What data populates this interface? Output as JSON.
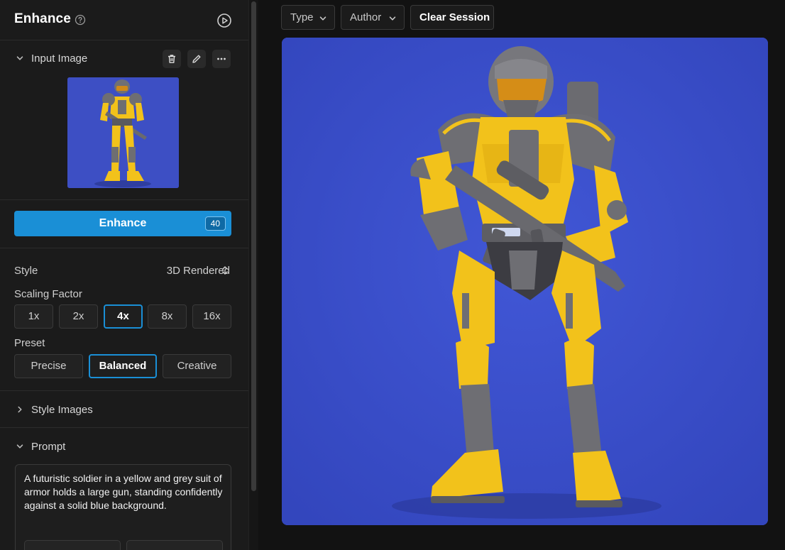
{
  "panel": {
    "title": "Enhance"
  },
  "input_image": {
    "label": "Input Image"
  },
  "enhance_button": {
    "label": "Enhance",
    "credits": "40"
  },
  "style": {
    "label": "Style",
    "value": "3D Rendered"
  },
  "scaling": {
    "label": "Scaling Factor",
    "options": [
      "1x",
      "2x",
      "4x",
      "8x",
      "16x"
    ],
    "selected": "4x"
  },
  "preset": {
    "label": "Preset",
    "options": [
      "Precise",
      "Balanced",
      "Creative"
    ],
    "selected": "Balanced"
  },
  "style_images": {
    "label": "Style Images"
  },
  "prompt": {
    "label": "Prompt",
    "text": "A futuristic soldier in a yellow and grey suit of armor holds a large gun, standing confidently against a solid blue background."
  },
  "toolbar": {
    "type_label": "Type",
    "author_label": "Author",
    "clear_label": "Clear Session"
  },
  "colors": {
    "accent": "#1a8fd6",
    "canvas_bg": "#3b4fc9",
    "armor_yellow": "#f2c21b",
    "armor_grey": "#6e6e72"
  }
}
